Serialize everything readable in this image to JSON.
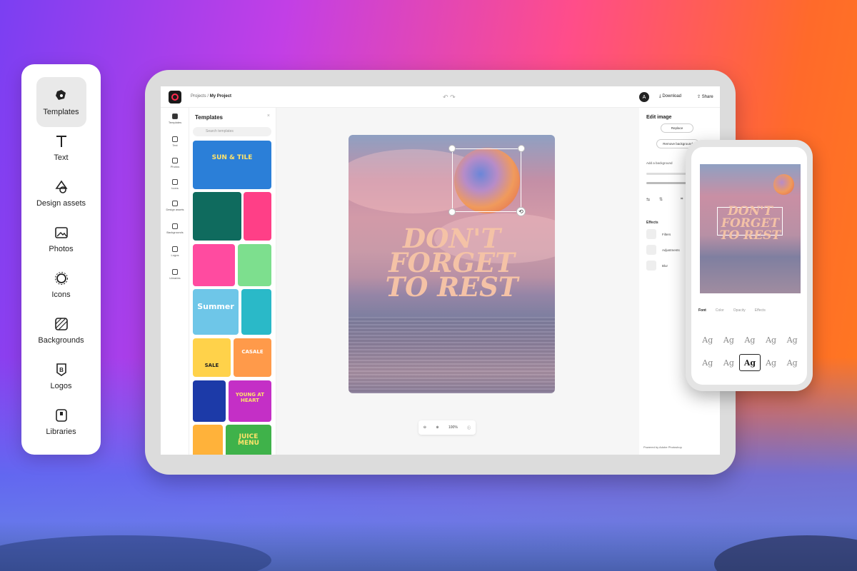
{
  "side_menu": {
    "items": [
      {
        "label": "Templates",
        "icon": "templates-icon",
        "active": true
      },
      {
        "label": "Text",
        "icon": "text-icon"
      },
      {
        "label": "Design assets",
        "icon": "shapes-icon"
      },
      {
        "label": "Photos",
        "icon": "photo-icon"
      },
      {
        "label": "Icons",
        "icon": "gear-icon"
      },
      {
        "label": "Backgrounds",
        "icon": "background-icon"
      },
      {
        "label": "Logos",
        "icon": "logo-icon"
      },
      {
        "label": "Libraries",
        "icon": "library-icon"
      }
    ]
  },
  "app": {
    "breadcrumb_root": "Projects",
    "project_name": "My Project",
    "download_label": "Download",
    "share_label": "Share",
    "avatar_initial": "A"
  },
  "rail": {
    "items": [
      "Templates",
      "Text",
      "Photos",
      "Icons",
      "Design assets",
      "Backgrounds",
      "Logos",
      "Libraries"
    ]
  },
  "templates_panel": {
    "title": "Templates",
    "search_placeholder": "Search templates",
    "thumbs": [
      {
        "text": "SUN & TILE"
      },
      {
        "text": "JUICE MENU"
      },
      {
        "text": "Summer"
      },
      {
        "text": "YOUNG AT HEART"
      },
      {
        "text": "CASALE"
      },
      {
        "text": "SALE"
      }
    ]
  },
  "canvas": {
    "headline_line1": "DON'T",
    "headline_line2": "FORGET",
    "headline_line3": "TO REST",
    "zoom": "100%"
  },
  "edit_panel": {
    "title": "Edit image",
    "replace_label": "Replace",
    "remove_bg_label": "Remove background",
    "add_bg_label": "Add a background",
    "effects_title": "Effects",
    "effects": [
      "Filters",
      "Adjustments",
      "Blur"
    ],
    "footer": "Powered by Adobe Photoshop"
  },
  "phone": {
    "headline_line1": "DON'T",
    "headline_line2": "FORGET",
    "headline_line3": "TO REST",
    "tabs": [
      "Font",
      "Color",
      "Opacity",
      "Effects"
    ],
    "font_cells": [
      "Ag",
      "Ag",
      "Ag",
      "Ag",
      "Ag",
      "Ag",
      "Ag",
      "Ag",
      "Ag",
      "Ag"
    ]
  }
}
